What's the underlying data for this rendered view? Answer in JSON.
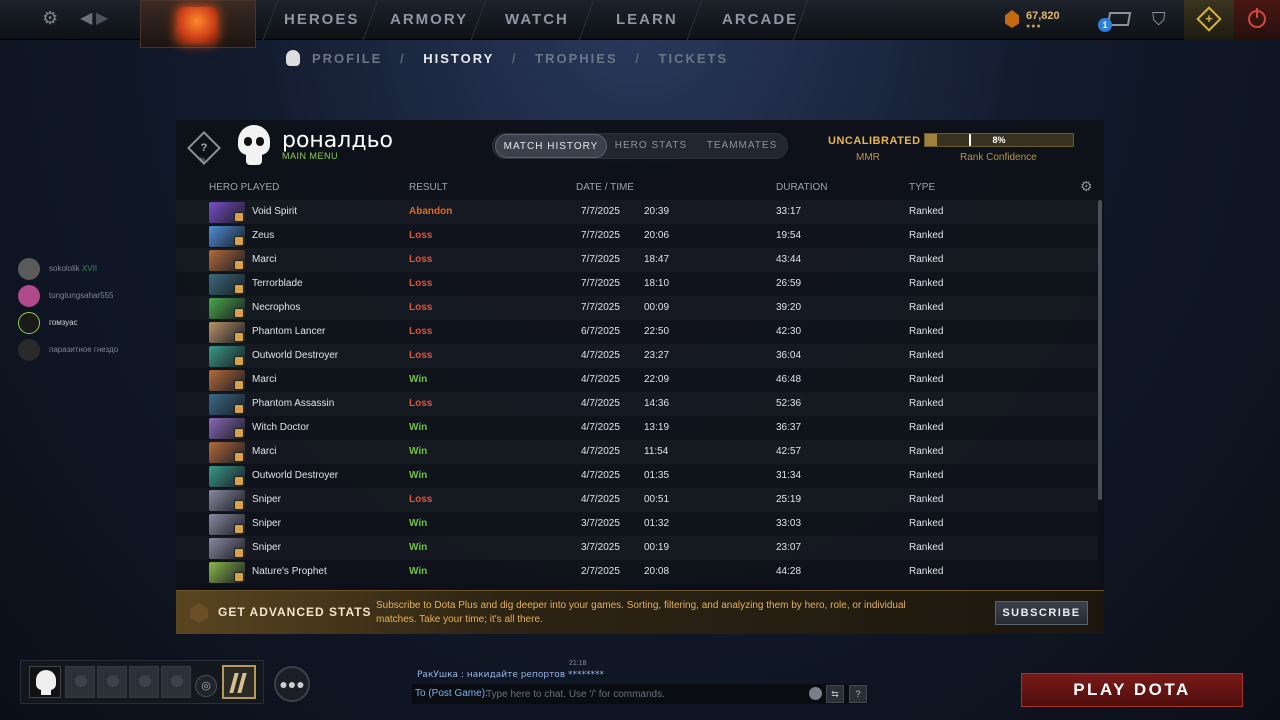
{
  "topbar": {
    "nav": [
      "HEROES",
      "ARMORY",
      "WATCH",
      "LEARN",
      "ARCADE"
    ],
    "gold": "67,820",
    "gold_dots": "●●●",
    "mail_count": "1"
  },
  "subnav": {
    "items": [
      "PROFILE",
      "HISTORY",
      "TROPHIES",
      "TICKETS"
    ],
    "separator": "/"
  },
  "profile": {
    "rank_symbol": "?",
    "rank_pct": "%",
    "name": "роналдьо",
    "status": "MAIN MENU"
  },
  "tabs": [
    "MATCH HISTORY",
    "HERO STATS",
    "TEAMMATES"
  ],
  "calibration": {
    "status": "UNCALIBRATED",
    "mmr_label": "MMR",
    "confidence_label": "Rank Confidence",
    "confidence_text": "8%",
    "confidence_value": 0.08
  },
  "columns": {
    "hero": "HERO PLAYED",
    "result": "RESULT",
    "datetime": "DATE / TIME",
    "duration": "DURATION",
    "type": "TYPE"
  },
  "matches": [
    {
      "hero": "Void Spirit",
      "result": "Abandon",
      "date": "7/7/2025",
      "time": "20:39",
      "duration": "33:17",
      "type": "Ranked",
      "color": "#7a4fc9"
    },
    {
      "hero": "Zeus",
      "result": "Loss",
      "date": "7/7/2025",
      "time": "20:06",
      "duration": "19:54",
      "type": "Ranked",
      "color": "#4f8fd8"
    },
    {
      "hero": "Marci",
      "result": "Loss",
      "date": "7/7/2025",
      "time": "18:47",
      "duration": "43:44",
      "type": "Ranked",
      "color": "#b56a3a"
    },
    {
      "hero": "Terrorblade",
      "result": "Loss",
      "date": "7/7/2025",
      "time": "18:10",
      "duration": "26:59",
      "type": "Ranked",
      "color": "#3a6a7a"
    },
    {
      "hero": "Necrophos",
      "result": "Loss",
      "date": "7/7/2025",
      "time": "00:09",
      "duration": "39:20",
      "type": "Ranked",
      "color": "#4aa84a"
    },
    {
      "hero": "Phantom Lancer",
      "result": "Loss",
      "date": "6/7/2025",
      "time": "22:50",
      "duration": "42:30",
      "type": "Ranked",
      "color": "#b8946a"
    },
    {
      "hero": "Outworld Destroyer",
      "result": "Loss",
      "date": "4/7/2025",
      "time": "23:27",
      "duration": "36:04",
      "type": "Ranked",
      "color": "#3a9a8a"
    },
    {
      "hero": "Marci",
      "result": "Win",
      "date": "4/7/2025",
      "time": "22:09",
      "duration": "46:48",
      "type": "Ranked",
      "color": "#b56a3a"
    },
    {
      "hero": "Phantom Assassin",
      "result": "Loss",
      "date": "4/7/2025",
      "time": "14:36",
      "duration": "52:36",
      "type": "Ranked",
      "color": "#3a6a8a"
    },
    {
      "hero": "Witch Doctor",
      "result": "Win",
      "date": "4/7/2025",
      "time": "13:19",
      "duration": "36:37",
      "type": "Ranked",
      "color": "#8a6ab8"
    },
    {
      "hero": "Marci",
      "result": "Win",
      "date": "4/7/2025",
      "time": "11:54",
      "duration": "42:57",
      "type": "Ranked",
      "color": "#b56a3a"
    },
    {
      "hero": "Outworld Destroyer",
      "result": "Win",
      "date": "4/7/2025",
      "time": "01:35",
      "duration": "31:34",
      "type": "Ranked",
      "color": "#3a9a8a"
    },
    {
      "hero": "Sniper",
      "result": "Loss",
      "date": "4/7/2025",
      "time": "00:51",
      "duration": "25:19",
      "type": "Ranked",
      "color": "#8a8aa0"
    },
    {
      "hero": "Sniper",
      "result": "Win",
      "date": "3/7/2025",
      "time": "01:32",
      "duration": "33:03",
      "type": "Ranked",
      "color": "#8a8aa0"
    },
    {
      "hero": "Sniper",
      "result": "Win",
      "date": "3/7/2025",
      "time": "00:19",
      "duration": "23:07",
      "type": "Ranked",
      "color": "#8a8aa0"
    },
    {
      "hero": "Nature's Prophet",
      "result": "Win",
      "date": "2/7/2025",
      "time": "20:08",
      "duration": "44:28",
      "type": "Ranked",
      "color": "#8ab84a"
    }
  ],
  "promo": {
    "title": "GET ADVANCED STATS",
    "text": "Subscribe to Dota Plus and dig deeper into your games. Sorting, filtering, and analyzing them by hero, role, or individual matches. Take your time; it's all there.",
    "button": "SUBSCRIBE"
  },
  "friends": [
    {
      "name": "sokololik",
      "tag": "XVII"
    },
    {
      "name": "tungtungsahar555",
      "tag": ""
    },
    {
      "name": "гомзуас",
      "tag": ""
    },
    {
      "name": "паразитное гнездо",
      "tag": ""
    }
  ],
  "chat": {
    "time": "21:18",
    "line": "РакУшка : накидайте репортов ********",
    "to_label": "To (Post Game):",
    "placeholder": "Type here to chat. Use '/' for commands.",
    "help": "?"
  },
  "play_button": "PLAY DOTA",
  "colors": {
    "loss": "#e2513d",
    "win": "#6fc23e",
    "abandon": "#e36a1d",
    "accent_gold": "#e8b74a",
    "play_red": "#7a1a18"
  }
}
